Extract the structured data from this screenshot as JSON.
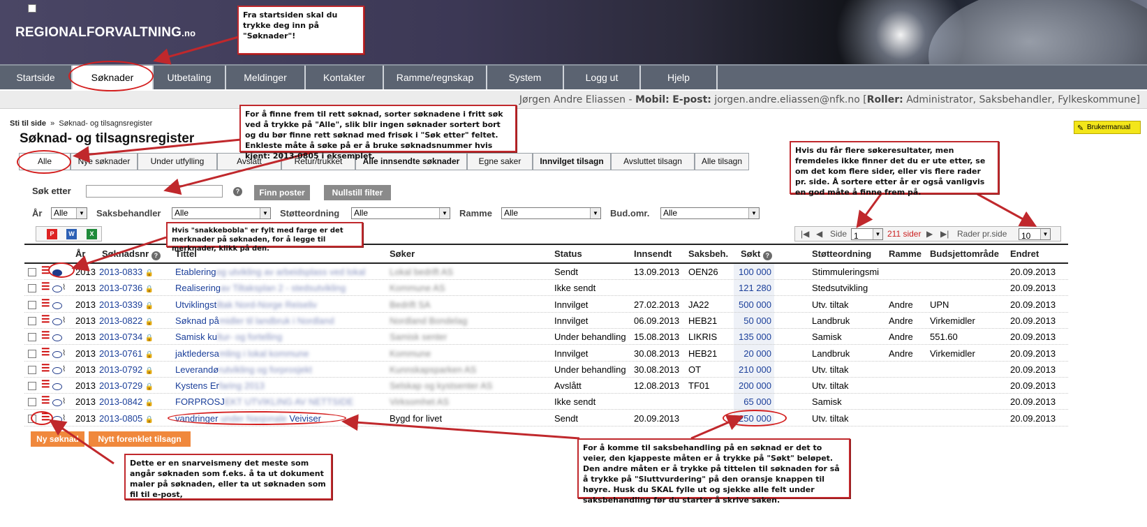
{
  "header": {
    "logo_main": "REGIONALFORVALTNING",
    "logo_suffix": ".no"
  },
  "nav": [
    "Startside",
    "Søknader",
    "Utbetaling",
    "Meldinger",
    "Kontakter",
    "Ramme/regnskap",
    "System",
    "Logg ut",
    "Hjelp"
  ],
  "user": {
    "name": "Jørgen Andre Eliassen",
    "mobile_label": "Mobil:",
    "email_label": "E-post:",
    "email": "jorgen.andre.eliassen@nfk.no",
    "roles_label": "Roller:",
    "roles": "Administrator, Saksbehandler, Fylkeskommune"
  },
  "breadcrumb": {
    "label": "Sti til side",
    "sep": "»",
    "current": "Søknad- og tilsagnsregister"
  },
  "manual_label": "Brukermanual",
  "page_title": "Søknad- og tilsagnsregister",
  "tabs": [
    "Alle",
    "Nye søknader",
    "Under utfylling",
    "Avslått",
    "Retur/trukket",
    "Alle innsendte søknader",
    "Egne saker",
    "Innvilget tilsagn",
    "Avsluttet tilsagn",
    "Alle tilsagn"
  ],
  "search": {
    "label": "Søk etter",
    "value": "",
    "find_btn": "Finn poster",
    "reset_btn": "Nullstill filter"
  },
  "filters": {
    "year_label": "År",
    "year_value": "Alle",
    "caseworker_label": "Saksbehandler",
    "caseworker_value": "Alle",
    "scheme_label": "Støtteordning",
    "scheme_value": "Alle",
    "frame_label": "Ramme",
    "frame_value": "Alle",
    "budget_label": "Bud.omr.",
    "budget_value": "Alle"
  },
  "export_icons": [
    "pdf-icon",
    "word-icon",
    "excel-icon"
  ],
  "pager": {
    "side_label": "Side",
    "page": "1",
    "pages": "211 sider",
    "rows_label": "Rader pr.side",
    "rows": "10"
  },
  "columns": [
    "År",
    "Søknadsnr",
    "Tittel",
    "Søker",
    "Status",
    "Innsendt",
    "Saksbeh.",
    "Søkt",
    "Støtteordning",
    "Ramme",
    "Budsjettområde",
    "Endret"
  ],
  "rows": [
    {
      "year": "2013",
      "nr": "2013-0833",
      "title": "Etablering",
      "title_blur": "og utvikling av arbeidsplass ved lokal",
      "applicant_blur": "Lokal bedrift AS",
      "status": "Sendt",
      "submitted": "13.09.2013",
      "caseworker": "OEN26",
      "amount": "100 000",
      "scheme": "Stimmuleringsmi",
      "frame": "",
      "budget": "",
      "changed": "20.09.2013",
      "bubble_filled": true,
      "clip": false
    },
    {
      "year": "2013",
      "nr": "2013-0736",
      "title": "Realisering",
      "title_blur": "av Tiltaksplan 2 - stedsutvikling",
      "applicant_blur": "Kommune AS",
      "status": "Ikke sendt",
      "submitted": "",
      "caseworker": "",
      "amount": "121 280",
      "scheme": "Stedsutvikling",
      "frame": "",
      "budget": "",
      "changed": "20.09.2013",
      "bubble_filled": false,
      "clip": true
    },
    {
      "year": "2013",
      "nr": "2013-0339",
      "title": "Utviklingst",
      "title_blur": "iltak Nord-Norge Reiseliv",
      "applicant_blur": "Bedrift SA",
      "status": "Innvilget",
      "submitted": "27.02.2013",
      "caseworker": "JA22",
      "amount": "500 000",
      "scheme": "Utv. tiltak",
      "frame": "Andre",
      "budget": "UPN",
      "changed": "20.09.2013",
      "bubble_filled": false,
      "clip": false
    },
    {
      "year": "2013",
      "nr": "2013-0822",
      "title": "Søknad på",
      "title_blur": "midler til landbruk i Nordland",
      "applicant_blur": "Nordland Bondelag",
      "status": "Innvilget",
      "submitted": "06.09.2013",
      "caseworker": "HEB21",
      "amount": "50 000",
      "scheme": "Landbruk",
      "frame": "Andre",
      "budget": "Virkemidler",
      "changed": "20.09.2013",
      "bubble_filled": false,
      "clip": true
    },
    {
      "year": "2013",
      "nr": "2013-0734",
      "title": "Samisk ku",
      "title_blur": "ltur- og fortelling",
      "applicant_blur": "Samisk senter",
      "status": "Under behandling",
      "submitted": "15.08.2013",
      "caseworker": "LIKRIS",
      "amount": "135 000",
      "scheme": "Samisk",
      "frame": "Andre",
      "budget": "551.60",
      "changed": "20.09.2013",
      "bubble_filled": false,
      "clip": false
    },
    {
      "year": "2013",
      "nr": "2013-0761",
      "title": "jaktledersa",
      "title_blur": "mling i lokal kommune",
      "applicant_blur": "Kommune",
      "status": "Innvilget",
      "submitted": "30.08.2013",
      "caseworker": "HEB21",
      "amount": "20 000",
      "scheme": "Landbruk",
      "frame": "Andre",
      "budget": "Virkemidler",
      "changed": "20.09.2013",
      "bubble_filled": false,
      "clip": true
    },
    {
      "year": "2013",
      "nr": "2013-0792",
      "title": "Leverandø",
      "title_blur": "rutvikling og forprosjekt",
      "applicant_blur": "Kunnskapsparken AS",
      "status": "Under behandling",
      "submitted": "30.08.2013",
      "caseworker": "OT",
      "amount": "210 000",
      "scheme": "Utv. tiltak",
      "frame": "",
      "budget": "",
      "changed": "20.09.2013",
      "bubble_filled": false,
      "clip": true
    },
    {
      "year": "2013",
      "nr": "2013-0729",
      "title": "Kystens Er",
      "title_blur": "faring 2013",
      "applicant_blur": "Selskap og kystsenter AS",
      "status": "Avslått",
      "submitted": "12.08.2013",
      "caseworker": "TF01",
      "amount": "200 000",
      "scheme": "Utv. tiltak",
      "frame": "",
      "budget": "",
      "changed": "20.09.2013",
      "bubble_filled": false,
      "clip": false
    },
    {
      "year": "2013",
      "nr": "2013-0842",
      "title": "FORPROSJ",
      "title_blur": "EKT UTVIKLING AV NETTSIDE",
      "applicant_blur": "Virksomhet AS",
      "status": "Ikke sendt",
      "submitted": "",
      "caseworker": "",
      "amount": "65 000",
      "scheme": "Samisk",
      "frame": "",
      "budget": "",
      "changed": "20.09.2013",
      "bubble_filled": false,
      "clip": true
    },
    {
      "year": "2013",
      "nr": "2013-0805",
      "title": "vandringer",
      "title_blur": "under Nasjonale",
      "title_extra": "Veiviser",
      "applicant": "Bygd for livet",
      "status": "Sendt",
      "submitted": "20.09.2013",
      "caseworker": "",
      "amount": "250 000",
      "scheme": "Utv. tiltak",
      "frame": "",
      "budget": "",
      "changed": "20.09.2013",
      "bubble_filled": false,
      "clip": true
    }
  ],
  "buttons": {
    "new_application": "Ny søknad",
    "new_grant": "Nytt forenklet tilsagn"
  },
  "callouts": {
    "c1": "Fra startsiden skal du trykke deg inn på \"Søknader\"!",
    "c2": "For å finne frem til rett søknad, sorter søknadene i fritt søk ved å trykke på \"Alle\", slik blir ingen søknader sortert bort og du bør finne rett søknad med frisøk i \"Søk etter\" feltet. Enkleste måte å søke på er å bruke søknadsnummer hvis kjent: 2013-0805 i eksemplet.",
    "c3": "Hvis du får flere søkeresultater, men fremdeles ikke finner det du er ute etter, se om det kom flere sider, eller vis flere rader pr. side. Å sortere etter år er også vanligvis en god måte å finne frem på.",
    "c4": "Hvis \"snakkebobla\" er fylt med farge er det merknader på søknaden, for å legge til merknader, klikk på den.",
    "c5": "Dette er en snarveismeny det meste som angår søknaden som f.eks. å ta ut dokument maler på søknaden, eller ta ut søknaden som fil til e-post,",
    "c6": "For å komme til saksbehandling på en søknad er det to veier, den kjappeste måten er å trykke på \"Søkt\" beløpet. Den andre måten er å trykke på tittelen til søknaden for så å trykke på \"Sluttvurdering\" på den oransje knappen til høyre. Husk du SKAL fylle ut og sjekke alle felt under saksbehandling før du starter å skrive saken."
  },
  "colors": {
    "nav_bg": "#5b6371",
    "link": "#1b3f9a",
    "callout_border": "#c0282c",
    "orange_btn": "#f0883c",
    "pages_red": "#cc1f1f"
  }
}
